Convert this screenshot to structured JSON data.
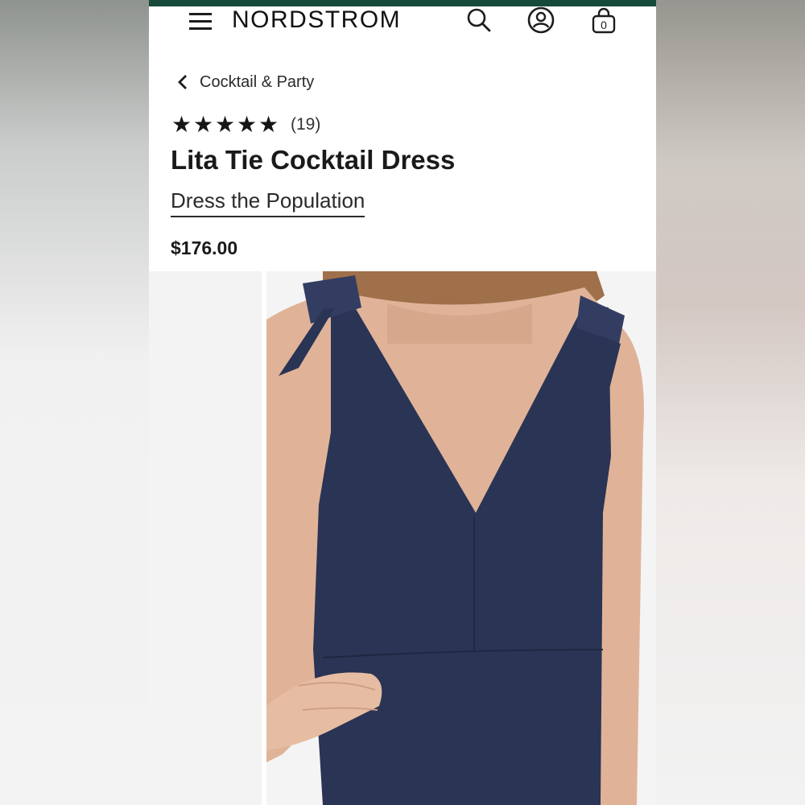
{
  "header": {
    "brand": "NORDSTROM",
    "brand_color": "#174a3b",
    "icons": [
      "menu-icon",
      "search-icon",
      "account-icon",
      "bag-icon"
    ],
    "bag_count": "0"
  },
  "breadcrumb": {
    "label": "Cocktail & Party"
  },
  "product": {
    "rating": 5,
    "rating_max": 5,
    "review_count": "(19)",
    "title": "Lita Tie Cocktail Dress",
    "brand": "Dress the Population",
    "price": "$176.00",
    "dress_color": "#283352"
  }
}
